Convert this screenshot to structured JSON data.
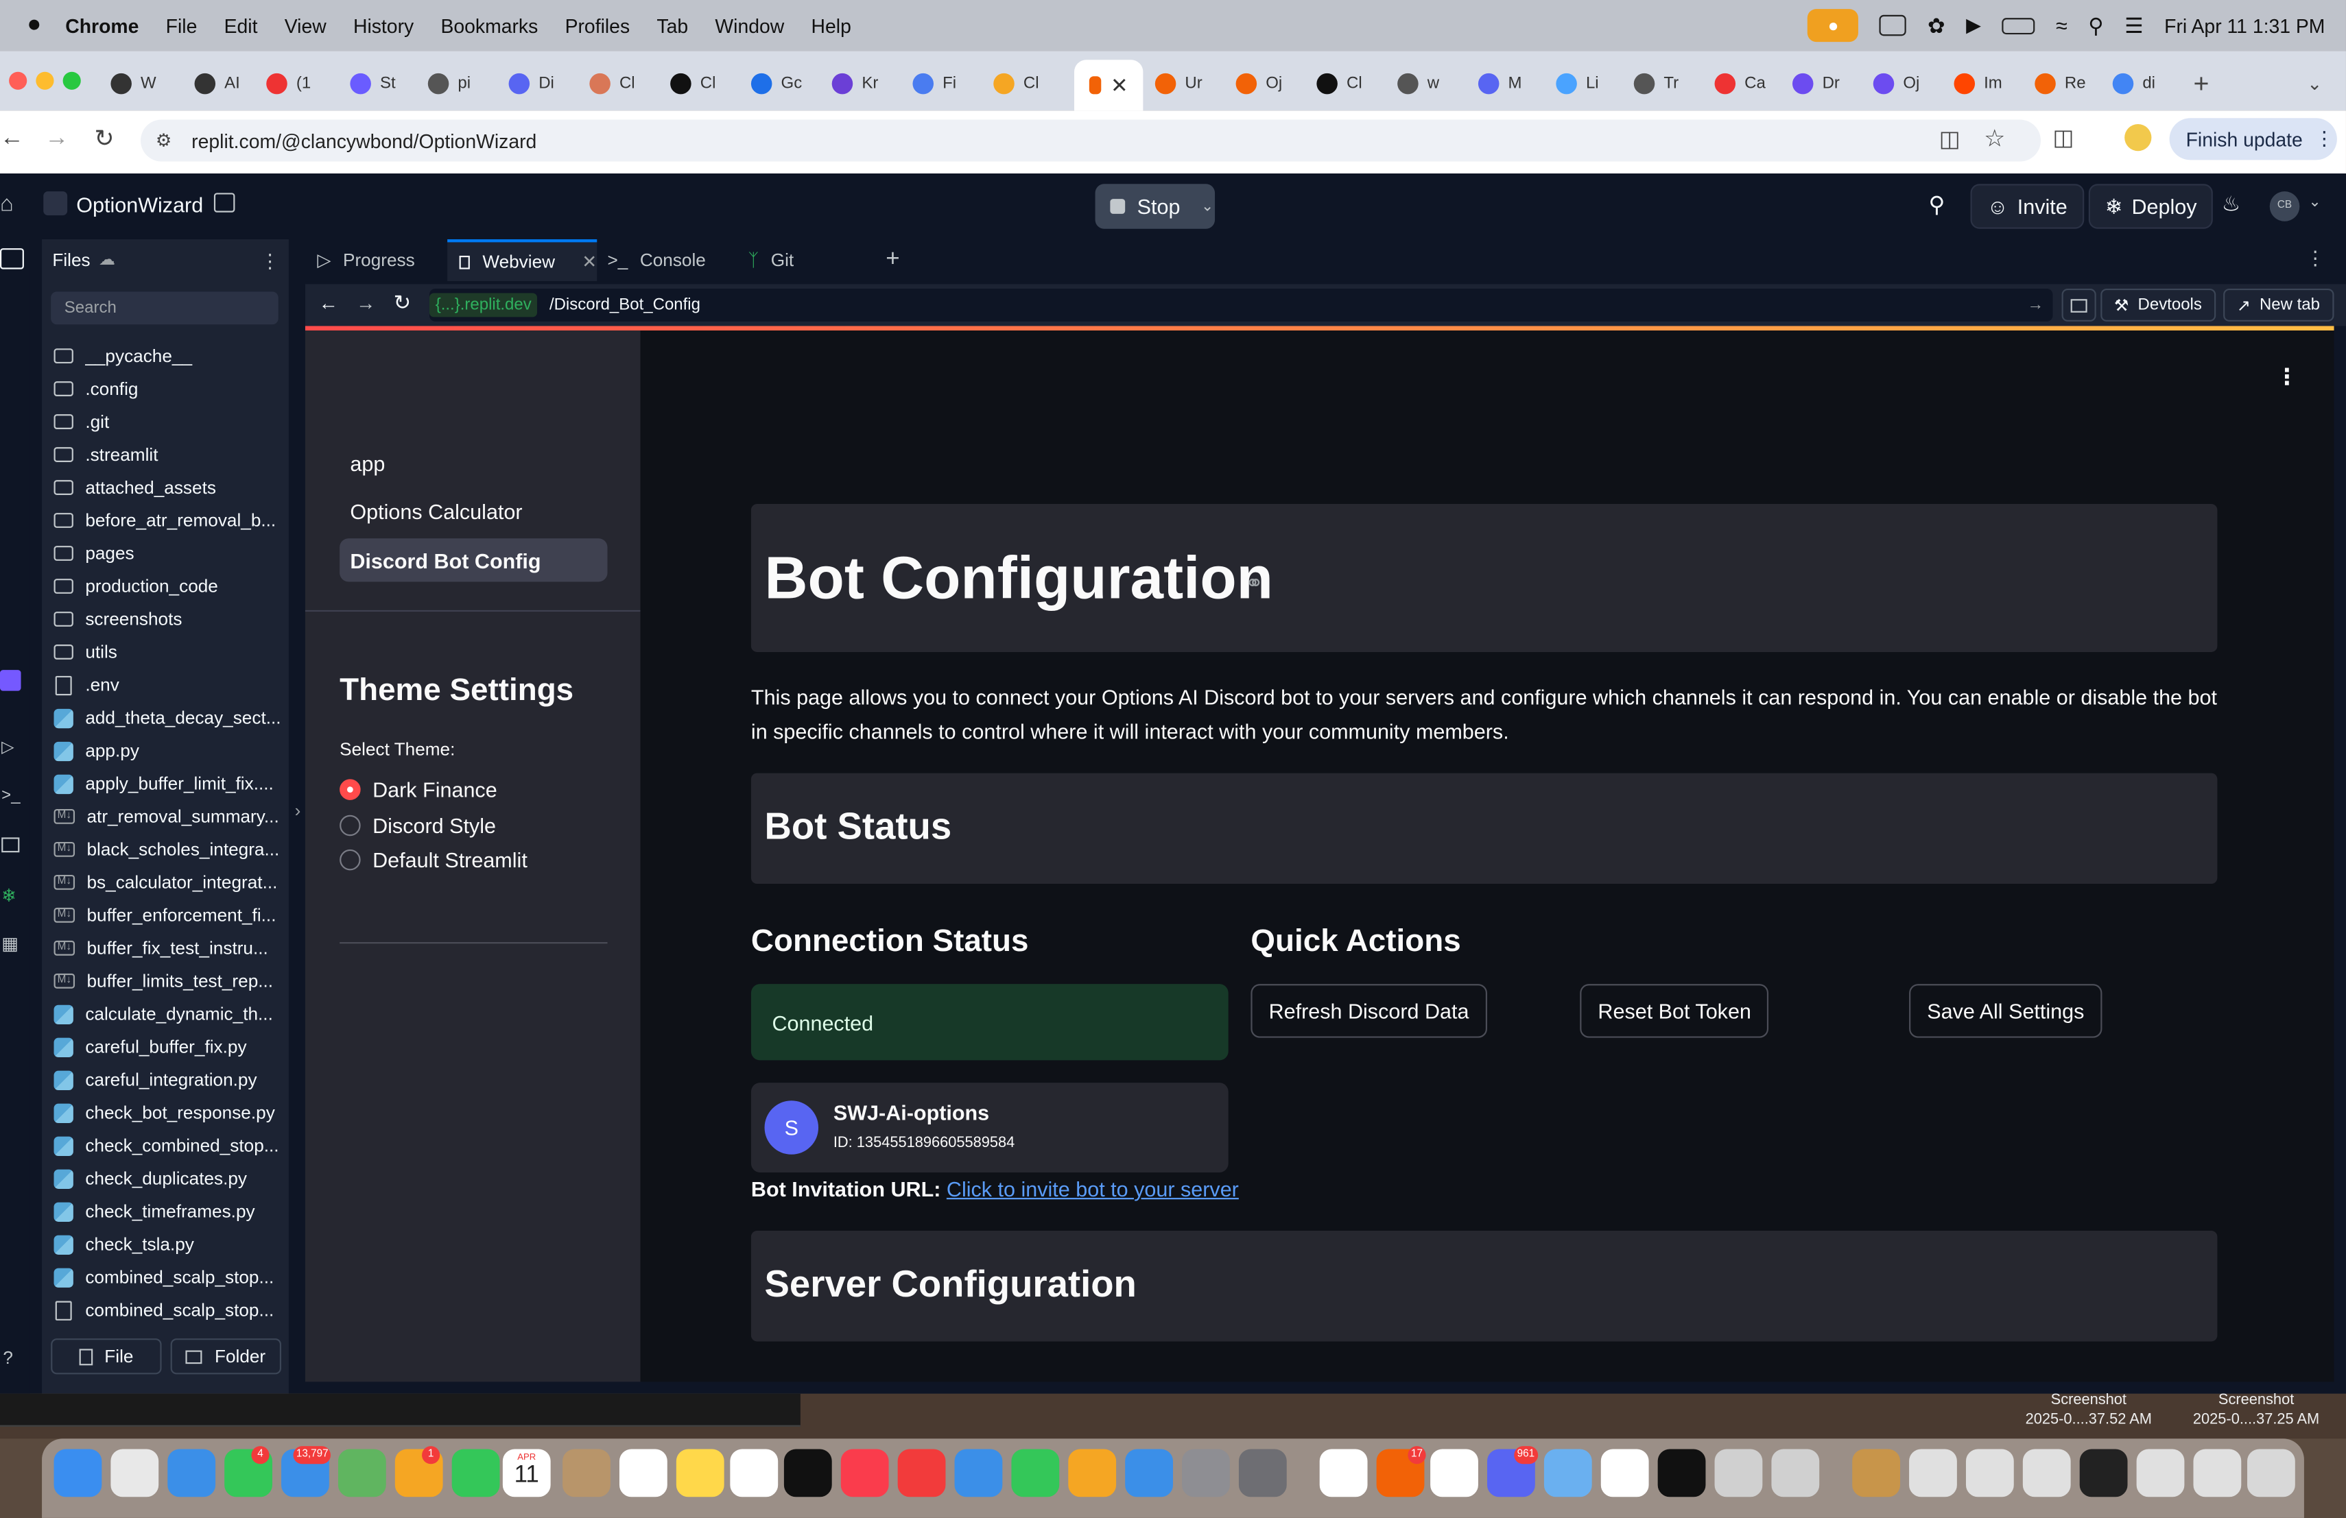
{
  "menubar": {
    "app": "Chrome",
    "items": [
      "File",
      "Edit",
      "View",
      "History",
      "Bookmarks",
      "Profiles",
      "Tab",
      "Window",
      "Help"
    ],
    "datetime": "Fri Apr 11  1:31 PM"
  },
  "tabs": [
    {
      "label": "W",
      "color": "#333"
    },
    {
      "label": "AI",
      "color": "#333"
    },
    {
      "label": "(1",
      "color": "#e33"
    },
    {
      "label": "St",
      "color": "#6a5cff"
    },
    {
      "label": "pi",
      "color": "#555"
    },
    {
      "label": "Di",
      "color": "#5865f2"
    },
    {
      "label": "Cl",
      "color": "#d97757"
    },
    {
      "label": "Cl",
      "color": "#111"
    },
    {
      "label": "Gc",
      "color": "#1e6fe8"
    },
    {
      "label": "Kr",
      "color": "#6b3fd6"
    },
    {
      "label": "Fi",
      "color": "#4a7cf0"
    },
    {
      "label": "Cl",
      "color": "#f5a623"
    },
    {
      "label": "Ur",
      "color": "#f26207"
    },
    {
      "label": "Oj",
      "color": "#f26207"
    },
    {
      "label": "Cl",
      "color": "#111"
    },
    {
      "label": "w",
      "color": "#555"
    },
    {
      "label": "M",
      "color": "#5865f2"
    },
    {
      "label": "Li",
      "color": "#4aa3ff"
    },
    {
      "label": "Tr",
      "color": "#555"
    },
    {
      "label": "Ca",
      "color": "#e33"
    },
    {
      "label": "Dr",
      "color": "#6c4cf0"
    },
    {
      "label": "Oj",
      "color": "#6c4cf0"
    },
    {
      "label": "Im",
      "color": "#ff4500"
    },
    {
      "label": "Re",
      "color": "#f26207"
    },
    {
      "label": "di",
      "color": "#4285f4"
    }
  ],
  "address": {
    "url": "replit.com/@clancywbond/OptionWizard",
    "finish_update": "Finish update"
  },
  "replit": {
    "project": "OptionWizard",
    "stop": "Stop",
    "invite": "Invite",
    "deploy": "Deploy",
    "avatar": "CB",
    "files_title": "Files",
    "search_placeholder": "Search",
    "file_btn": "File",
    "folder_btn": "Folder",
    "files": [
      {
        "name": "__pycache__",
        "type": "folder"
      },
      {
        "name": ".config",
        "type": "folder"
      },
      {
        "name": ".git",
        "type": "folder"
      },
      {
        "name": ".streamlit",
        "type": "folder"
      },
      {
        "name": "attached_assets",
        "type": "folder"
      },
      {
        "name": "before_atr_removal_b...",
        "type": "folder"
      },
      {
        "name": "pages",
        "type": "folder"
      },
      {
        "name": "production_code",
        "type": "folder"
      },
      {
        "name": "screenshots",
        "type": "folder"
      },
      {
        "name": "utils",
        "type": "folder"
      },
      {
        "name": ".env",
        "type": "file"
      },
      {
        "name": "add_theta_decay_sect...",
        "type": "py"
      },
      {
        "name": "app.py",
        "type": "py"
      },
      {
        "name": "apply_buffer_limit_fix....",
        "type": "py"
      },
      {
        "name": "atr_removal_summary...",
        "type": "md"
      },
      {
        "name": "black_scholes_integra...",
        "type": "md"
      },
      {
        "name": "bs_calculator_integrat...",
        "type": "md"
      },
      {
        "name": "buffer_enforcement_fi...",
        "type": "md"
      },
      {
        "name": "buffer_fix_test_instru...",
        "type": "md"
      },
      {
        "name": "buffer_limits_test_rep...",
        "type": "md"
      },
      {
        "name": "calculate_dynamic_th...",
        "type": "py"
      },
      {
        "name": "careful_buffer_fix.py",
        "type": "py"
      },
      {
        "name": "careful_integration.py",
        "type": "py"
      },
      {
        "name": "check_bot_response.py",
        "type": "py"
      },
      {
        "name": "check_combined_stop...",
        "type": "py"
      },
      {
        "name": "check_duplicates.py",
        "type": "py"
      },
      {
        "name": "check_timeframes.py",
        "type": "py"
      },
      {
        "name": "check_tsla.py",
        "type": "py"
      },
      {
        "name": "combined_scalp_stop...",
        "type": "py"
      },
      {
        "name": "combined_scalp_stop...",
        "type": "file"
      }
    ],
    "panel_tabs": [
      "Progress",
      "Webview",
      "Console",
      "Git"
    ],
    "webview_host": "{...}.replit.dev",
    "webview_path": "/Discord_Bot_Config",
    "devtools": "Devtools",
    "new_tab": "New tab"
  },
  "streamlit": {
    "nav": [
      "app",
      "Options Calculator",
      "Discord Bot Config"
    ],
    "theme_title": "Theme Settings",
    "theme_label": "Select Theme:",
    "themes": [
      "Dark Finance",
      "Discord Style",
      "Default Streamlit"
    ],
    "selected_theme": "Dark Finance",
    "page_title": "Bot Configuration",
    "description": "This page allows you to connect your Options AI Discord bot to your servers and configure which channels it can respond in. You can enable or disable the bot in specific channels to control where it will interact with your community members.",
    "bot_status": "Bot Status",
    "connection_status": "Connection Status",
    "connected": "Connected",
    "quick_actions": "Quick Actions",
    "actions": [
      "Refresh Discord Data",
      "Reset Bot Token",
      "Save All Settings"
    ],
    "server_initial": "S",
    "server_name": "SWJ-Ai-options",
    "server_id": "ID: 1354551896605589584",
    "invite_label": "Bot Invitation URL:",
    "invite_link": "Click to invite bot to your server",
    "server_config": "Server Configuration",
    "accent": "#ff4b4b",
    "link_color": "#5a9cf8"
  },
  "desktop": {
    "screenshots": [
      {
        "title": "Screenshot",
        "sub": "2025-0....37.52 AM"
      },
      {
        "title": "Screenshot",
        "sub": "2025-0....37.25 AM"
      }
    ],
    "dock_badges": [
      "4",
      "13,797",
      "1",
      "17",
      "961"
    ],
    "calendar_month": "APR",
    "calendar_day": "11"
  }
}
